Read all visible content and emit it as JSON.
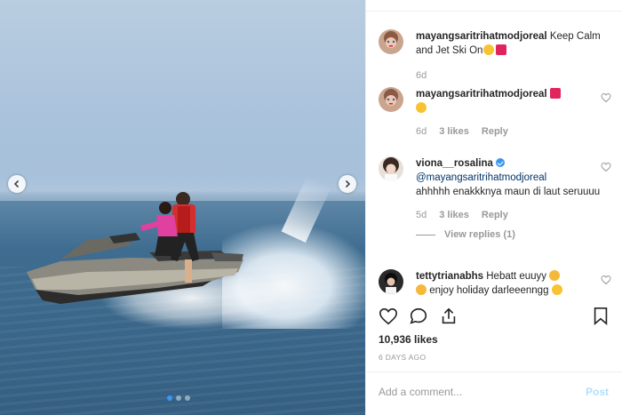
{
  "comments": [
    {
      "username": "mayangsaritrihatmodjoreal",
      "text": "Keep Calm and Jet Ski On",
      "time": "6d"
    },
    {
      "username": "mayangsaritrihatmodjoreal",
      "text": "",
      "time": "6d",
      "likes": "3 likes",
      "reply": "Reply"
    },
    {
      "username": "viona__rosalina",
      "mention": "@mayangsaritrihatmodjoreal",
      "text": "ahhhhh enakkknya maun di laut seruuuu",
      "time": "5d",
      "likes": "3 likes",
      "reply": "Reply",
      "view_replies": "View replies (1)"
    },
    {
      "username": "tettytrianabhs",
      "text": "Hebatt euuyy",
      "text2": "enjoy holiday darleeenngg"
    }
  ],
  "likes_count": "10,936 likes",
  "posted": "6 DAYS AGO",
  "add_comment": {
    "placeholder": "Add a comment...",
    "post_label": "Post"
  },
  "carousel": {
    "total_slides": 3,
    "active_slide": 1
  },
  "colors": {
    "link": "#003569",
    "accent": "#3897f0",
    "post_disabled": "#b2dffc",
    "muted": "#999999"
  }
}
